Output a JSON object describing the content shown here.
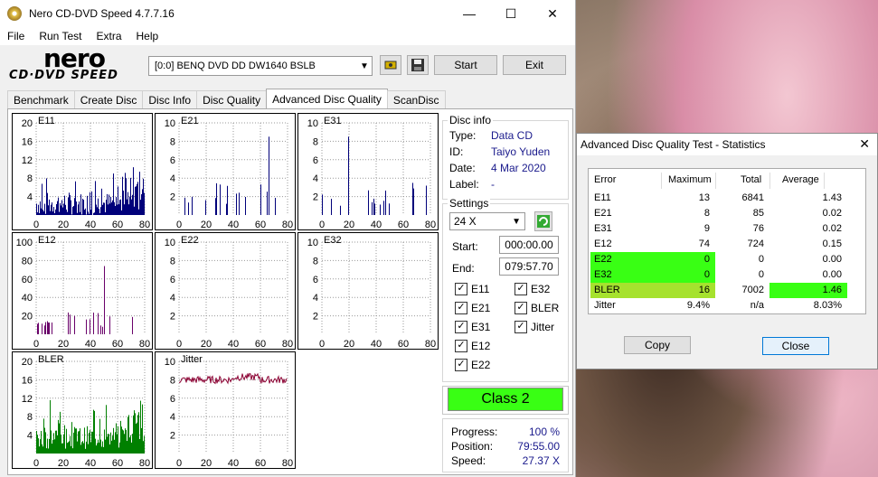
{
  "window": {
    "title": "Nero CD-DVD Speed 4.7.7.16"
  },
  "menu": [
    "File",
    "Run Test",
    "Extra",
    "Help"
  ],
  "logo": {
    "line1": "nero",
    "line2": "CD·DVD SPEED"
  },
  "drive": {
    "selected": "[0:0]   BENQ DVD DD DW1640 BSLB"
  },
  "buttons": {
    "start": "Start",
    "exit": "Exit"
  },
  "tabs": [
    "Benchmark",
    "Create Disc",
    "Disc Info",
    "Disc Quality",
    "Advanced Disc Quality",
    "ScanDisc"
  ],
  "active_tab": "Advanced Disc Quality",
  "disc_info": {
    "heading": "Disc info",
    "rows": [
      {
        "label": "Type:",
        "value": "Data CD"
      },
      {
        "label": "ID:",
        "value": "Taiyo Yuden"
      },
      {
        "label": "Date:",
        "value": "4 Mar 2020"
      },
      {
        "label": "Label:",
        "value": "-"
      }
    ]
  },
  "settings": {
    "heading": "Settings",
    "speed": "24 X",
    "start_label": "Start:",
    "start_value": "000:00.00",
    "end_label": "End:",
    "end_value": "079:57.70",
    "checks": [
      {
        "label": "E11",
        "checked": true
      },
      {
        "label": "E32",
        "checked": true
      },
      {
        "label": "E21",
        "checked": true
      },
      {
        "label": "BLER",
        "checked": true
      },
      {
        "label": "E31",
        "checked": true
      },
      {
        "label": "Jitter",
        "checked": true
      },
      {
        "label": "E12",
        "checked": true
      },
      {
        "label": "E22",
        "checked": true
      }
    ]
  },
  "class_label": "Class 2",
  "progress": {
    "rows": [
      {
        "label": "Progress:",
        "value": "100 %"
      },
      {
        "label": "Position:",
        "value": "79:55.00"
      },
      {
        "label": "Speed:",
        "value": "27.37 X"
      }
    ]
  },
  "colors": {
    "class_green": "#39ff14",
    "graph_blue": "#00007a",
    "graph_purple": "#6a006a",
    "graph_green": "#008000",
    "jitter_red": "#8b0032"
  },
  "chart_data": [
    {
      "type": "bar",
      "name": "E11",
      "x": [
        0,
        20,
        40,
        60,
        80
      ],
      "ylim": [
        0,
        20
      ],
      "yticks": [
        4,
        8,
        12,
        16,
        20
      ]
    },
    {
      "type": "bar",
      "name": "E21",
      "x": [
        0,
        20,
        40,
        60,
        80
      ],
      "ylim": [
        0,
        10
      ],
      "yticks": [
        2,
        4,
        6,
        8,
        10
      ]
    },
    {
      "type": "bar",
      "name": "E31",
      "x": [
        0,
        20,
        40,
        60,
        80
      ],
      "ylim": [
        0,
        10
      ],
      "yticks": [
        2,
        4,
        6,
        8,
        10
      ]
    },
    {
      "type": "bar",
      "name": "E12",
      "x": [
        0,
        20,
        40,
        60,
        80
      ],
      "ylim": [
        0,
        100
      ],
      "yticks": [
        20,
        40,
        60,
        80,
        100
      ]
    },
    {
      "type": "bar",
      "name": "E22",
      "x": [
        0,
        20,
        40,
        60,
        80
      ],
      "ylim": [
        0,
        10
      ],
      "yticks": [
        2,
        4,
        6,
        8,
        10
      ]
    },
    {
      "type": "bar",
      "name": "E32",
      "x": [
        0,
        20,
        40,
        60,
        80
      ],
      "ylim": [
        0,
        10
      ],
      "yticks": [
        2,
        4,
        6,
        8,
        10
      ]
    },
    {
      "type": "bar",
      "name": "BLER",
      "x": [
        0,
        20,
        40,
        60,
        80
      ],
      "ylim": [
        0,
        20
      ],
      "yticks": [
        4,
        8,
        12,
        16,
        20
      ]
    },
    {
      "type": "line",
      "name": "Jitter",
      "x": [
        0,
        20,
        40,
        60,
        80
      ],
      "ylim": [
        0,
        10
      ],
      "yticks": [
        2,
        4,
        6,
        8,
        10
      ]
    }
  ],
  "dialog": {
    "title": "Advanced Disc Quality Test - Statistics",
    "headers": [
      "Error",
      "Maximum",
      "Total",
      "Average"
    ],
    "rows": [
      {
        "name": "E11",
        "max": "13",
        "total": "6841",
        "avg": "1.43"
      },
      {
        "name": "E21",
        "max": "8",
        "total": "85",
        "avg": "0.02"
      },
      {
        "name": "E31",
        "max": "9",
        "total": "76",
        "avg": "0.02"
      },
      {
        "name": "E12",
        "max": "74",
        "total": "724",
        "avg": "0.15"
      },
      {
        "name": "E22",
        "max": "0",
        "total": "0",
        "avg": "0.00"
      },
      {
        "name": "E32",
        "max": "0",
        "total": "0",
        "avg": "0.00"
      },
      {
        "name": "BLER",
        "max": "16",
        "total": "7002",
        "avg": "1.46"
      },
      {
        "name": "Jitter",
        "max": "9.4%",
        "total": "n/a",
        "avg": "8.03%"
      }
    ],
    "copy": "Copy",
    "close": "Close"
  }
}
